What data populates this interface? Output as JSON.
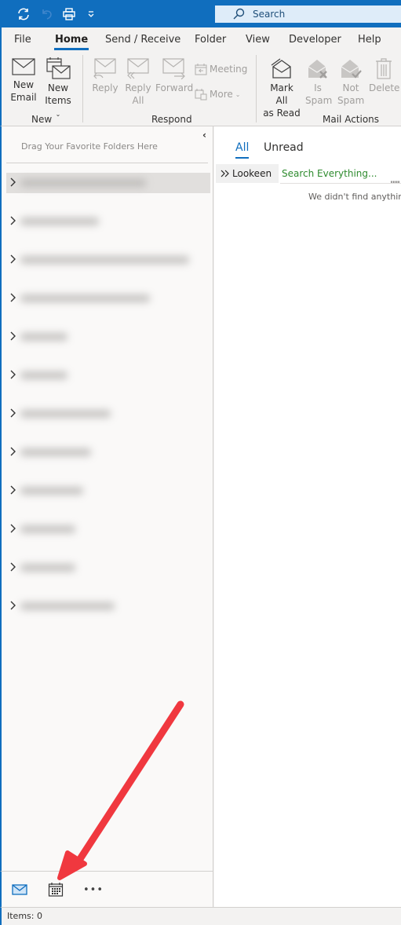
{
  "titlebar": {
    "quick_access": [
      {
        "name": "send-receive-all-icon",
        "enabled": true
      },
      {
        "name": "undo-icon",
        "enabled": false
      },
      {
        "name": "print-icon",
        "enabled": true
      },
      {
        "name": "customize-quick-access-icon",
        "enabled": true
      }
    ],
    "search_placeholder": "Search"
  },
  "menu": {
    "tabs": [
      {
        "label": "File",
        "active": false
      },
      {
        "label": "Home",
        "active": true
      },
      {
        "label": "Send / Receive",
        "active": false
      },
      {
        "label": "Folder",
        "active": false
      },
      {
        "label": "View",
        "active": false
      },
      {
        "label": "Developer",
        "active": false
      },
      {
        "label": "Help",
        "active": false
      }
    ]
  },
  "ribbon": {
    "groups": {
      "new": {
        "label": "New",
        "new_email": {
          "line1": "New",
          "line2": "Email"
        },
        "new_items": {
          "line1": "New",
          "line2": "Items"
        }
      },
      "respond": {
        "label": "Respond",
        "reply": {
          "line1": "Reply"
        },
        "reply_all": {
          "line1": "Reply",
          "line2": "All"
        },
        "forward": {
          "line1": "Forward"
        },
        "meeting": "Meeting",
        "more": "More"
      },
      "mail_actions": {
        "label": "Mail Actions",
        "mark_all_read": {
          "line1": "Mark All",
          "line2": "as Read"
        },
        "is_spam": {
          "line1": "Is",
          "line2": "Spam"
        },
        "not_spam": {
          "line1": "Not",
          "line2": "Spam"
        },
        "delete": {
          "line1": "Delete"
        }
      }
    }
  },
  "folder_pane": {
    "favorites_hint": "Drag Your Favorite Folders Here",
    "folders": [
      {
        "label": "[redacted]",
        "selected": true
      },
      {
        "label": "[redacted]",
        "selected": false
      },
      {
        "label": "[redacted]",
        "selected": false
      },
      {
        "label": "[redacted]",
        "selected": false
      },
      {
        "label": "[redacted]",
        "selected": false
      },
      {
        "label": "[redacted]",
        "selected": false
      },
      {
        "label": "[redacted]",
        "selected": false
      },
      {
        "label": "[redacted]",
        "selected": false
      },
      {
        "label": "[redacted]",
        "selected": false
      },
      {
        "label": "[redacted]",
        "selected": false
      },
      {
        "label": "[redacted]",
        "selected": false
      },
      {
        "label": "[redacted]",
        "selected": false
      }
    ]
  },
  "module_nav": {
    "items": [
      {
        "name": "mail",
        "active": true
      },
      {
        "name": "calendar",
        "active": false
      },
      {
        "name": "more",
        "active": false
      }
    ],
    "more_label": "•••"
  },
  "message_list": {
    "filters": [
      {
        "label": "All",
        "active": true
      },
      {
        "label": "Unread",
        "active": false
      }
    ],
    "lookeen_label": "Lookeen",
    "lookeen_search_placeholder": "Search Everything...",
    "empty_message": "We didn't find anything to show here."
  },
  "status_bar": {
    "items_text": "Items: 0"
  },
  "colors": {
    "accent": "#106ebe",
    "annotation_arrow": "#f0383f",
    "lookeen_green": "#2e8b2e"
  }
}
